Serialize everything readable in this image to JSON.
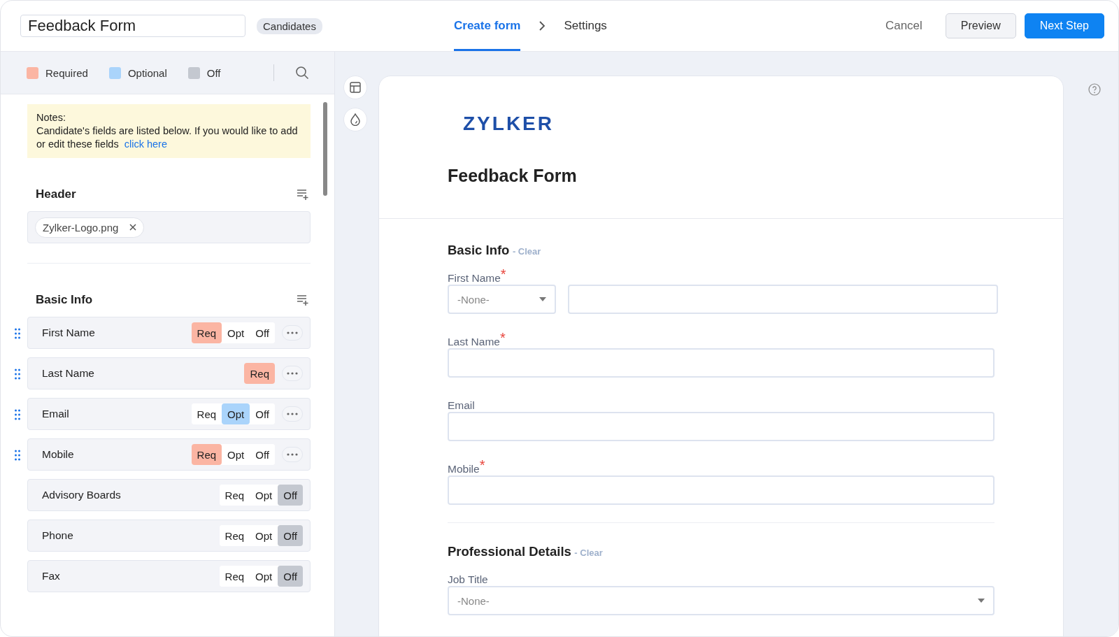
{
  "form_name": {
    "value": "Feedback Form"
  },
  "module_badge": "Candidates",
  "steps": [
    {
      "label": "Create form",
      "selected": true
    },
    {
      "label": "Settings",
      "selected": false
    }
  ],
  "actions": [
    {
      "label": "Cancel",
      "kind": "link"
    },
    {
      "label": "Preview",
      "kind": "secondary"
    },
    {
      "label": "Next Step",
      "kind": "primary"
    }
  ],
  "legend": [
    {
      "label": "Required",
      "color": "#fbb5a3"
    },
    {
      "label": "Optional",
      "color": "#aad4fb"
    },
    {
      "label": "Off",
      "color": "#c4c8d0"
    }
  ],
  "notes": {
    "title": "Notes:",
    "text": "Candidate's fields are listed below. If you would like to add or edit these fields",
    "link": "click here"
  },
  "header_section": {
    "title": "Header",
    "file": "Zylker-Logo.png"
  },
  "basic_info": {
    "title": "Basic Info",
    "fields": [
      {
        "label": "First Name",
        "draggable": true,
        "menu": true,
        "options": [
          {
            "label": "Req",
            "kind": "req",
            "selected": true
          },
          {
            "label": "Opt",
            "kind": "opt",
            "selected": false
          },
          {
            "label": "Off",
            "kind": "off",
            "selected": false
          }
        ]
      },
      {
        "label": "Last Name",
        "draggable": true,
        "menu": true,
        "options": [
          {
            "label": "Req",
            "kind": "req",
            "selected": true
          }
        ]
      },
      {
        "label": "Email",
        "draggable": true,
        "menu": true,
        "options": [
          {
            "label": "Req",
            "kind": "req",
            "selected": false
          },
          {
            "label": "Opt",
            "kind": "opt",
            "selected": true
          },
          {
            "label": "Off",
            "kind": "off",
            "selected": false
          }
        ]
      },
      {
        "label": "Mobile",
        "draggable": true,
        "menu": true,
        "options": [
          {
            "label": "Req",
            "kind": "req",
            "selected": true
          },
          {
            "label": "Opt",
            "kind": "opt",
            "selected": false
          },
          {
            "label": "Off",
            "kind": "off",
            "selected": false
          }
        ]
      },
      {
        "label": "Advisory Boards",
        "draggable": false,
        "menu": false,
        "options": [
          {
            "label": "Req",
            "kind": "req",
            "selected": false
          },
          {
            "label": "Opt",
            "kind": "opt",
            "selected": false
          },
          {
            "label": "Off",
            "kind": "off",
            "selected": true
          }
        ]
      },
      {
        "label": "Phone",
        "draggable": false,
        "menu": false,
        "options": [
          {
            "label": "Req",
            "kind": "req",
            "selected": false
          },
          {
            "label": "Opt",
            "kind": "opt",
            "selected": false
          },
          {
            "label": "Off",
            "kind": "off",
            "selected": true
          }
        ]
      },
      {
        "label": "Fax",
        "draggable": false,
        "menu": false,
        "options": [
          {
            "label": "Req",
            "kind": "req",
            "selected": false
          },
          {
            "label": "Opt",
            "kind": "opt",
            "selected": false
          },
          {
            "label": "Off",
            "kind": "off",
            "selected": true
          }
        ]
      }
    ]
  },
  "preview": {
    "logo": "ZYLKER",
    "title": "Feedback Form",
    "required_mark": "*",
    "sections": [
      {
        "title": "Basic Info",
        "clear": "- Clear",
        "fields": [
          {
            "label": "First Name",
            "required": true,
            "kind": "select-text",
            "placeholder": "-None-"
          },
          {
            "label": "Last Name",
            "required": true,
            "kind": "text"
          },
          {
            "label": "Email",
            "required": false,
            "kind": "text"
          },
          {
            "label": "Mobile",
            "required": true,
            "kind": "text"
          }
        ]
      },
      {
        "title": "Professional Details",
        "clear": "- Clear",
        "fields": [
          {
            "label": "Job Title",
            "required": false,
            "kind": "select",
            "placeholder": "-None-"
          }
        ]
      }
    ]
  }
}
